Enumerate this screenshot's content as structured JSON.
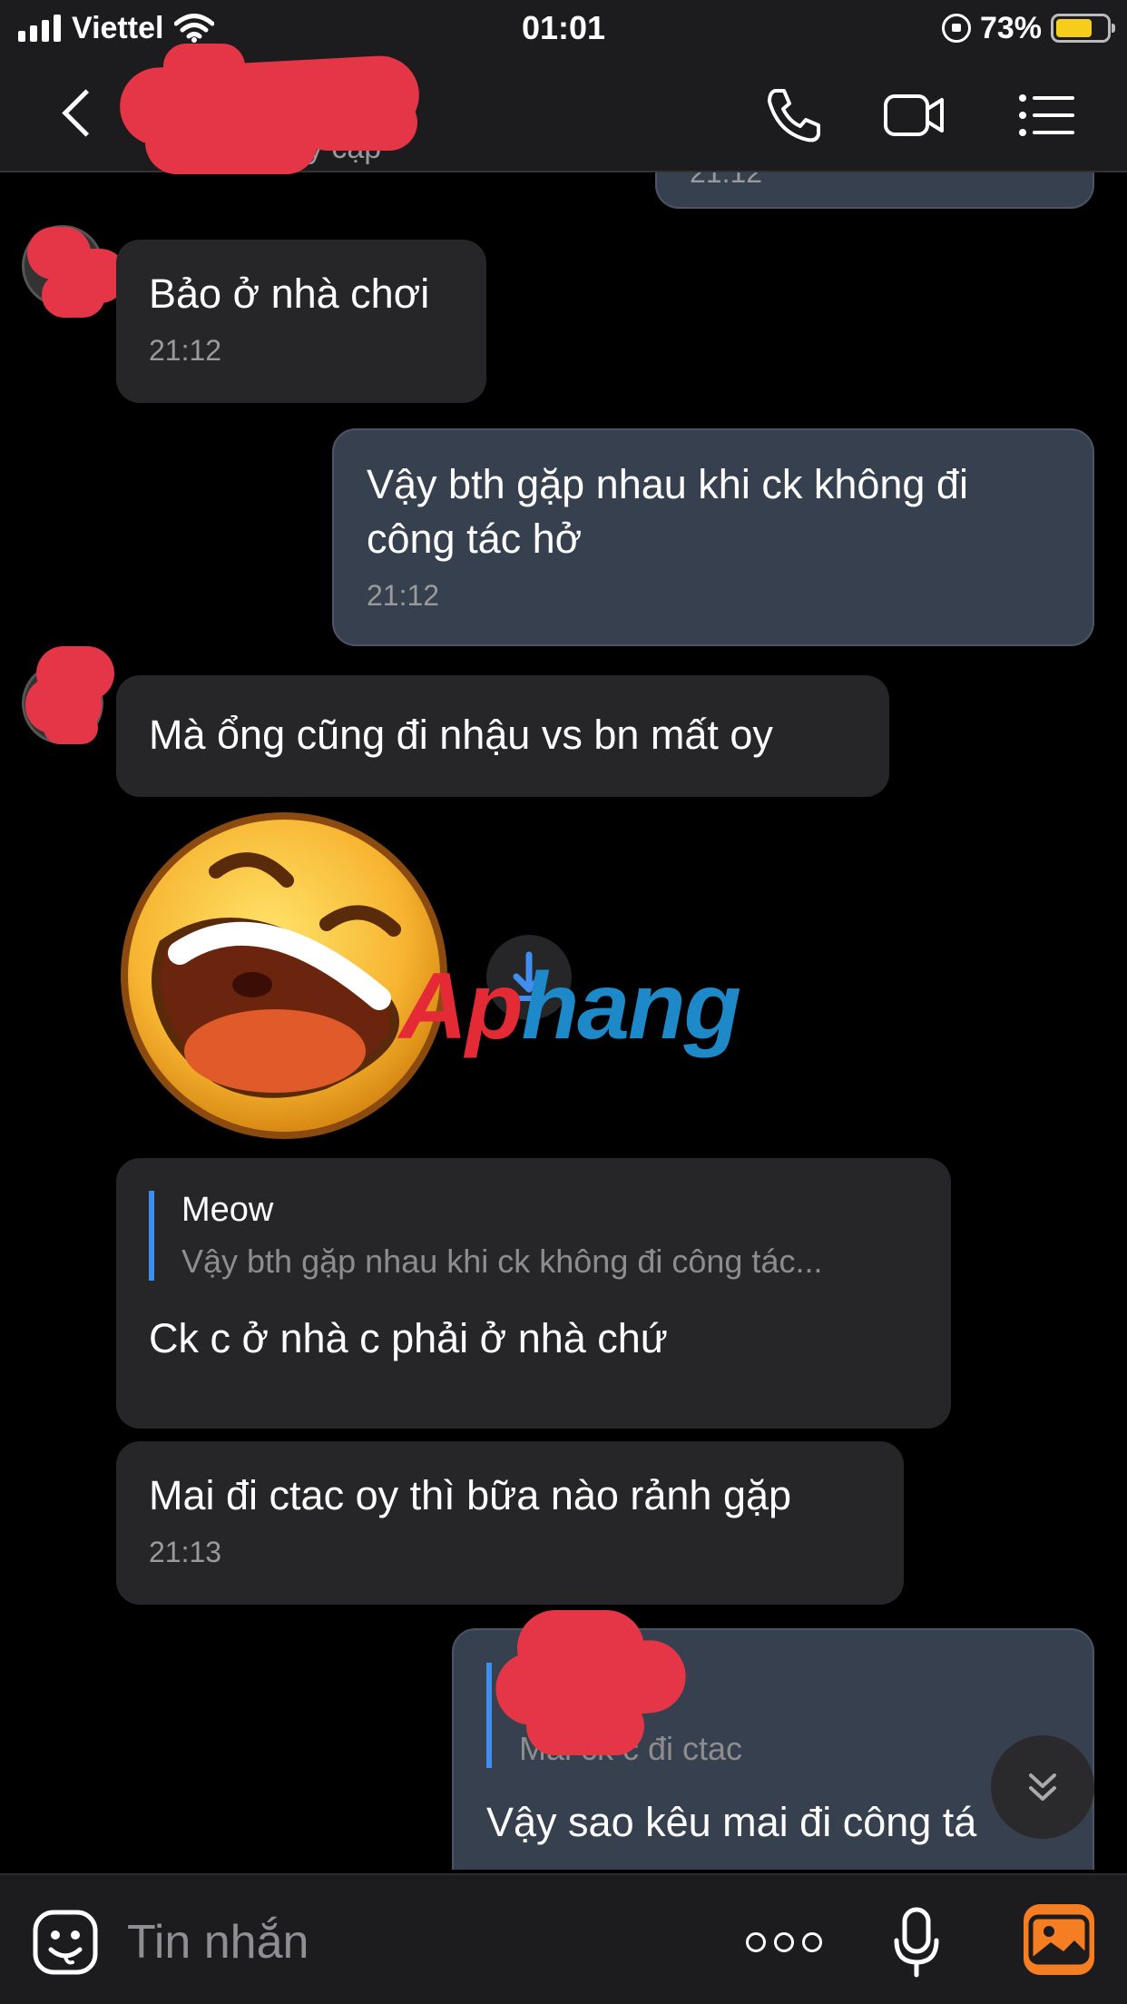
{
  "status_bar": {
    "carrier": "Viettel",
    "time": "01:01",
    "battery_percent": "73%",
    "battery_level": 0.73,
    "signal_bars": 4,
    "icons": [
      "signal-icon",
      "wifi-icon",
      "orientation-lock-icon",
      "battery-icon"
    ]
  },
  "header": {
    "contact_status": "uy cập",
    "icons": [
      "back-icon",
      "phone-icon",
      "video-call-icon",
      "menu-icon"
    ]
  },
  "messages": [
    {
      "id": "m0",
      "direction": "outgoing",
      "time": "21:12"
    },
    {
      "id": "m1",
      "direction": "incoming",
      "text": "Bảo ở nhà chơi",
      "time": "21:12"
    },
    {
      "id": "m2",
      "direction": "outgoing",
      "text": "Vậy bth gặp nhau khi ck không đi\ncông tác hở",
      "time": "21:12"
    },
    {
      "id": "m3",
      "direction": "incoming",
      "text": "Mà ổng cũng đi nhậu vs bn mất oy"
    },
    {
      "id": "m4",
      "direction": "incoming",
      "type": "sticker",
      "sticker": "laughing-emoji-sticker"
    },
    {
      "id": "m5",
      "direction": "incoming",
      "quote_name": "Meow",
      "quote_text": "Vậy bth gặp nhau khi ck không đi công tác...",
      "text": "Ck c ở nhà c phải ở nhà chứ"
    },
    {
      "id": "m6",
      "direction": "incoming",
      "text": "Mai đi ctac oy thì bữa nào rảnh gặp",
      "time": "21:13"
    },
    {
      "id": "m7",
      "direction": "outgoing",
      "quote_text": "Mai ck c đi ctac",
      "text": "Vậy sao kêu mai đi công tá"
    }
  ],
  "watermark": {
    "part1": "Ap",
    "part2": "hang"
  },
  "input_bar": {
    "placeholder": "Tin nhắn",
    "icons": [
      "emoji-icon",
      "more-icon",
      "microphone-icon",
      "gallery-icon"
    ]
  },
  "colors": {
    "background": "#000000",
    "bar": "#1c1c1e",
    "incoming_bubble": "#262628",
    "outgoing_bubble": "#36404e",
    "quote_accent": "#3f8fef",
    "redaction": "#e43647",
    "gallery_accent": "#f57d22"
  }
}
